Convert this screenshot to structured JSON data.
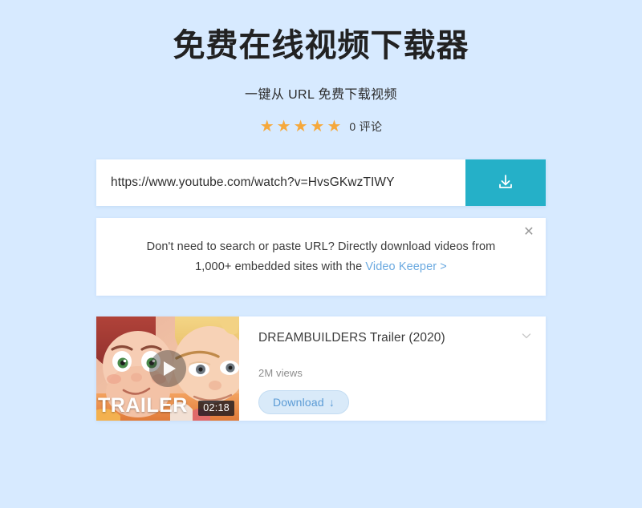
{
  "page": {
    "background_color": "#d7eaff",
    "accent_color": "#25b0c8",
    "link_color": "#6aa9e0",
    "star_color": "#f5a83c"
  },
  "header": {
    "title": "免费在线视频下载器",
    "subtitle": "一键从 URL 免费下载视频",
    "rating": {
      "stars_filled": 5,
      "star_glyph": "★",
      "reviews_label": "0 评论"
    }
  },
  "search": {
    "url_value": "https://www.youtube.com/watch?v=HvsGKwzTIWY",
    "placeholder": "https://www.youtube.com/watch?v=HvsGKwzTIWY",
    "button_icon": "download-icon"
  },
  "notice": {
    "text_before_link": "Don't need to search or paste URL? Directly download videos from 1,000+ embedded sites with the ",
    "link_label": "Video Keeper >",
    "close_icon": "✕"
  },
  "result": {
    "title": "DREAMBUILDERS Trailer (2020)",
    "views": "2M views",
    "download_label": "Download",
    "download_arrow": "↓",
    "duration": "02:18",
    "thumbnail_label": "TRAILER",
    "play_icon": "play-icon",
    "expand_icon": "chevron-down-icon"
  }
}
